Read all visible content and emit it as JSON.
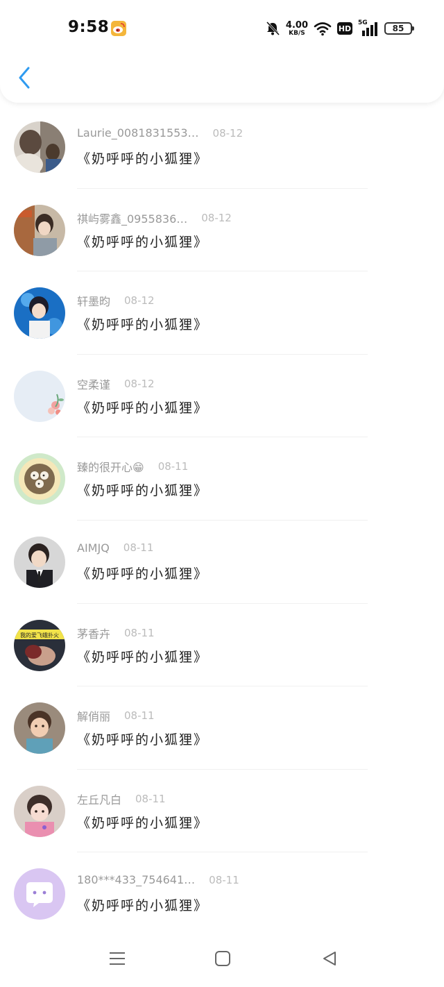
{
  "status_bar": {
    "time": "9:58",
    "net_speed_value": "4.00",
    "net_speed_unit": "KB/S",
    "hd_label": "HD",
    "signal_label": "5G",
    "battery": "85",
    "icons": [
      "weibo-icon",
      "bell-muted-icon",
      "wifi-icon",
      "hd-icon",
      "signal-icon",
      "battery-icon"
    ]
  },
  "header": {
    "back_icon": "chevron-left-icon"
  },
  "comments": [
    {
      "name": "Laurie_0081831553…",
      "date": "08-12",
      "message": "《奶呼呼的小狐狸》"
    },
    {
      "name": "祺屿雾鑫_0955836…",
      "date": "08-12",
      "message": "《奶呼呼的小狐狸》"
    },
    {
      "name": "轩墨昀",
      "date": "08-12",
      "message": "《奶呼呼的小狐狸》"
    },
    {
      "name": "空柔谨",
      "date": "08-12",
      "message": "《奶呼呼的小狐狸》"
    },
    {
      "name": "臻的很开心😁",
      "date": "08-11",
      "message": "《奶呼呼的小狐狸》"
    },
    {
      "name": "AIMJQ",
      "date": "08-11",
      "message": "《奶呼呼的小狐狸》"
    },
    {
      "name": "茅香卉",
      "date": "08-11",
      "message": "《奶呼呼的小狐狸》"
    },
    {
      "name": "解俏丽",
      "date": "08-11",
      "message": "《奶呼呼的小狐狸》"
    },
    {
      "name": "左丘凡白",
      "date": "08-11",
      "message": "《奶呼呼的小狐狸》"
    },
    {
      "name": "180***433_754641…",
      "date": "08-11",
      "message": "《奶呼呼的小狐狸》"
    }
  ],
  "avatar_overlay_text": "我的爱飞蛾扑火",
  "nav_bar": {
    "icons": [
      "menu-icon",
      "home-icon",
      "back-triangle-icon"
    ]
  },
  "colors": {
    "accent": "#2f9bf0",
    "name": "#999999",
    "date": "#bbbbbb",
    "message": "#222222",
    "default_avatar_bg": "#d9c6f2"
  }
}
